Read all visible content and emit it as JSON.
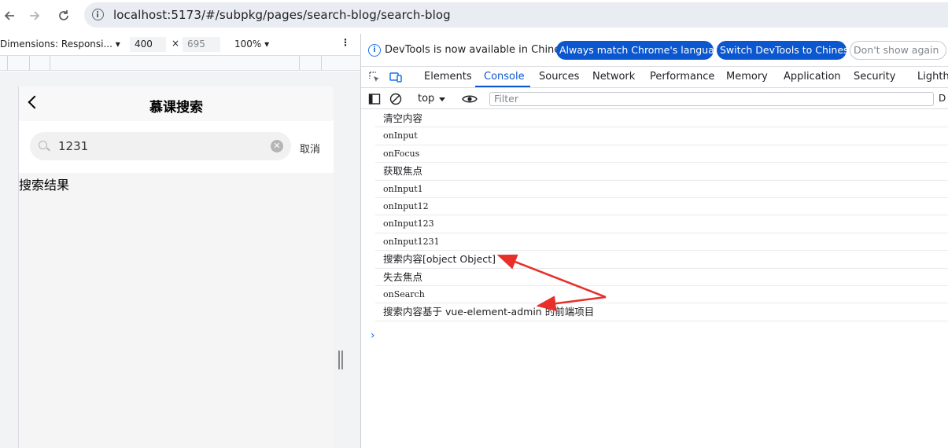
{
  "browser": {
    "url": "localhost:5173/#/subpkg/pages/search-blog/search-blog"
  },
  "device_toolbar": {
    "dimensions_label": "Dimensions: Responsi...",
    "width": "400",
    "times": "×",
    "height": "695",
    "zoom": "100%"
  },
  "page": {
    "title": "慕课搜索",
    "search_value": "1231",
    "cancel_label": "取消",
    "result_label": "搜索结果"
  },
  "devtools": {
    "info_message": "DevTools is now available in Chinese!",
    "btn_match": "Always match Chrome's language",
    "btn_switch": "Switch DevTools to Chinese",
    "btn_dismiss": "Don't show again",
    "tabs": [
      "Elements",
      "Console",
      "Sources",
      "Network",
      "Performance",
      "Memory",
      "Application",
      "Security",
      "Lighthouse"
    ],
    "active_tab": "Console",
    "context": "top",
    "filter_placeholder": "Filter",
    "right_cut": "D",
    "logs": [
      "清空内容",
      "onInput",
      "onFocus",
      "获取焦点",
      "onInput1",
      "onInput12",
      "onInput123",
      "onInput1231",
      "搜索内容[object Object]",
      "失去焦点",
      "onSearch",
      "搜索内容基于 vue-element-admin 的前端项目"
    ],
    "prompt": "›"
  },
  "annotation": {
    "arrow_color": "#e8302a"
  }
}
